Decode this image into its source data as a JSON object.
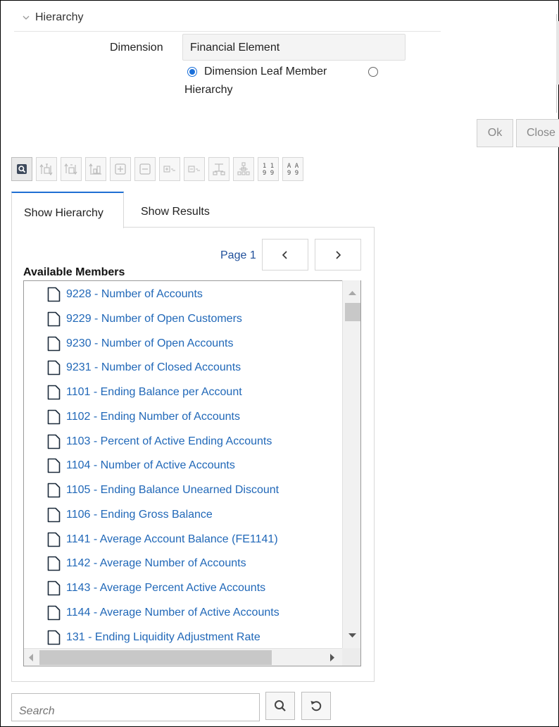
{
  "hierarchy": {
    "section_title": "Hierarchy",
    "dimension_label": "Dimension",
    "dimension_value": "Financial Element",
    "radio_leaf_label": "Dimension Leaf Member",
    "radio_hierarchy_label": "Hierarchy"
  },
  "dialog_buttons": {
    "ok": "Ok",
    "close": "Close"
  },
  "toolbar": {
    "icons": [
      "search-view-icon",
      "move-up-icon",
      "move-in-icon",
      "move-out-icon",
      "expand-icon",
      "collapse-icon",
      "expand-branch-icon",
      "collapse-branch-icon",
      "show-top-icon",
      "show-branch-icon",
      "sort-numeric-icon",
      "sort-alpha-icon"
    ],
    "sort_numeric_glyph_top": "1 1",
    "sort_numeric_glyph_bottom": "9 9",
    "sort_alpha_glyph_top": "A A",
    "sort_alpha_glyph_bottom": "9 9"
  },
  "tabs": {
    "hierarchy": "Show Hierarchy",
    "results": "Show Results"
  },
  "pagination": {
    "label": "Page 1"
  },
  "members": {
    "heading": "Available Members",
    "items": [
      "9228 - Number of Accounts",
      "9229 - Number of Open Customers",
      "9230 - Number of Open Accounts",
      "9231 - Number of Closed Accounts",
      "1101 - Ending Balance per Account",
      "1102 - Ending Number of Accounts",
      "1103 - Percent of Active Ending Accounts",
      "1104 - Number of Active Accounts",
      "1105 - Ending Balance Unearned Discount",
      "1106 - Ending Gross Balance",
      "1141 - Average Account Balance (FE1141)",
      "1142 - Average Number of Accounts",
      "1143 - Average Percent Active Accounts",
      "1144 - Average Number of Active Accounts",
      "131 - Ending Liquidity Adjustment Rate"
    ]
  },
  "search": {
    "placeholder": "Search"
  },
  "colors": {
    "accent": "#1f6fd3",
    "link": "#2168b8"
  }
}
